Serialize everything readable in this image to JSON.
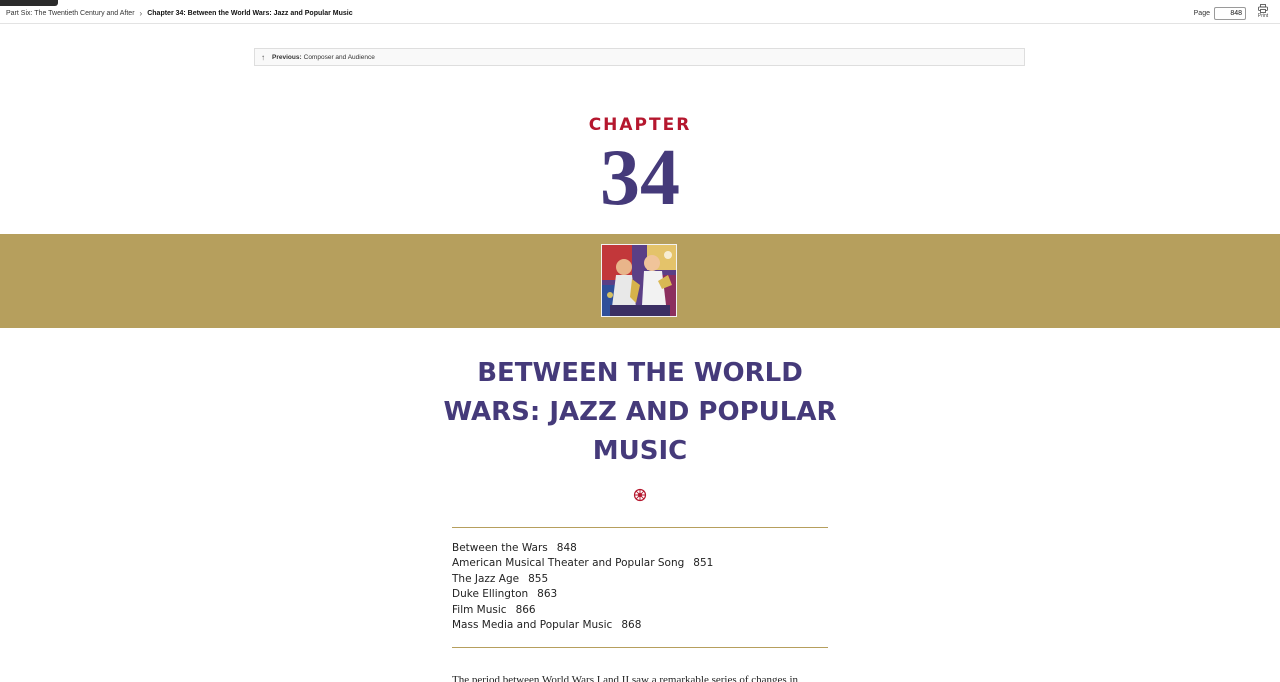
{
  "topbar": {
    "breadcrumb": {
      "part": "Part Six: The Twentieth Century and After",
      "separator": "›",
      "chapter": "Chapter 34: Between the World Wars: Jazz and Popular Music"
    },
    "page_label": "Page",
    "page_value": "848",
    "print_label": "Print"
  },
  "previous": {
    "arrow": "↑",
    "label": "Previous:",
    "title": "Composer and Audience"
  },
  "chapter": {
    "word": "CHAPTER",
    "number": "34"
  },
  "title": "BETWEEN THE WORLD WARS: JAZZ AND POPULAR MUSIC",
  "toc": [
    {
      "title": "Between the Wars",
      "page": "848"
    },
    {
      "title": "American Musical Theater and Popular Song",
      "page": "851"
    },
    {
      "title": "The Jazz Age",
      "page": "855"
    },
    {
      "title": "Duke Ellington",
      "page": "863"
    },
    {
      "title": "Film Music",
      "page": "866"
    },
    {
      "title": "Mass Media and Popular Music",
      "page": "868"
    }
  ],
  "body_start": "The period between World Wars I and II saw a remarkable series of changes in",
  "colors": {
    "accent_red": "#b5172e",
    "accent_purple": "#453a7a",
    "band_gold": "#b69f5d"
  },
  "icons": {
    "print": "printer-icon",
    "previous": "arrow-up-icon",
    "ornament": "ornament-icon"
  }
}
